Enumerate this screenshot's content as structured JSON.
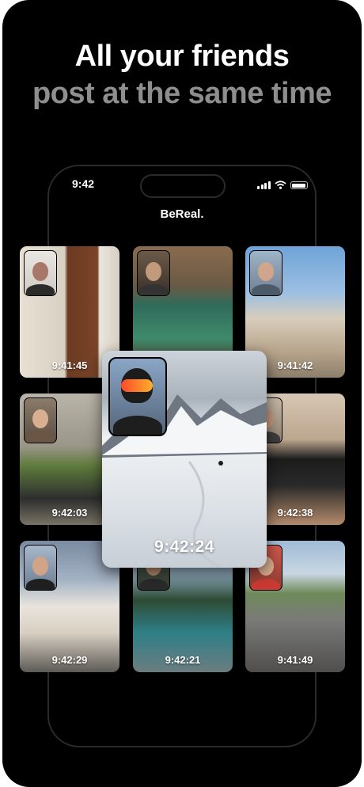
{
  "headline": {
    "line1": "All your friends",
    "line2": "post at the same time"
  },
  "phone": {
    "status_time": "9:42",
    "app_title": "BeReal.",
    "status_icons": [
      "cellular-signal-icon",
      "wifi-icon",
      "battery-icon"
    ]
  },
  "posts": [
    {
      "time": "9:41:45",
      "scene": "doorway-room"
    },
    {
      "time": "",
      "scene": "foosball-table"
    },
    {
      "time": "9:41:42",
      "scene": "city-street"
    },
    {
      "time": "9:42:03",
      "scene": "plant-sneakers"
    },
    {
      "time": "9:42:38",
      "scene": "black-white-cat"
    },
    {
      "time": "9:42:29",
      "scene": "ice-cream-street"
    },
    {
      "time": "9:42:21",
      "scene": "mountain-lake"
    },
    {
      "time": "9:41:49",
      "scene": "skatepark"
    }
  ],
  "featured_post": {
    "time": "9:42:24",
    "scene": "snowboarder-mountain"
  },
  "colors": {
    "background": "#000000",
    "headline_primary": "#ffffff",
    "headline_secondary": "#8e8e8e"
  }
}
